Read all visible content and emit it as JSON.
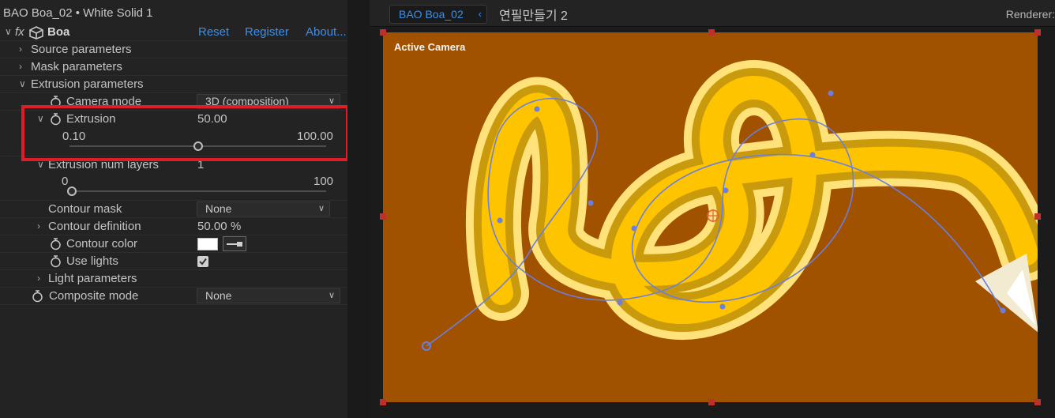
{
  "panel": {
    "title": "BAO Boa_02 • White Solid 1",
    "effect": {
      "fx_label": "fx",
      "name": "Boa",
      "reset_label": "Reset",
      "register_label": "Register",
      "about_label": "About..."
    },
    "groups": {
      "source": "Source parameters",
      "mask": "Mask parameters",
      "extrusion": "Extrusion parameters",
      "light": "Light parameters"
    },
    "camera_mode": {
      "label": "Camera mode",
      "value": "3D (composition)"
    },
    "extrusion": {
      "label": "Extrusion",
      "value": "50.00",
      "min": "0.10",
      "max": "100.00",
      "level": 0.5
    },
    "extrusion_layers": {
      "label": "Extrusion num layers",
      "value": "1",
      "min": "0",
      "max": "100",
      "level": 0.0
    },
    "contour_mask": {
      "label": "Contour mask",
      "value": "None"
    },
    "contour_definition": {
      "label": "Contour definition",
      "value": "50.00",
      "unit": "%"
    },
    "contour_color": {
      "label": "Contour color",
      "swatch": "#ffffff"
    },
    "use_lights": {
      "label": "Use lights",
      "checked": true
    },
    "composite_mode": {
      "label": "Composite mode",
      "value": "None"
    }
  },
  "viewer": {
    "comp_tab": "BAO Boa_02",
    "comp_tab2": "연필만들기 2",
    "renderer_label": "Renderer:",
    "camera_label": "Active Camera",
    "background_color": "#a05200",
    "highlight_color": "#e01c24",
    "accent_color": "#3f8ee6"
  }
}
